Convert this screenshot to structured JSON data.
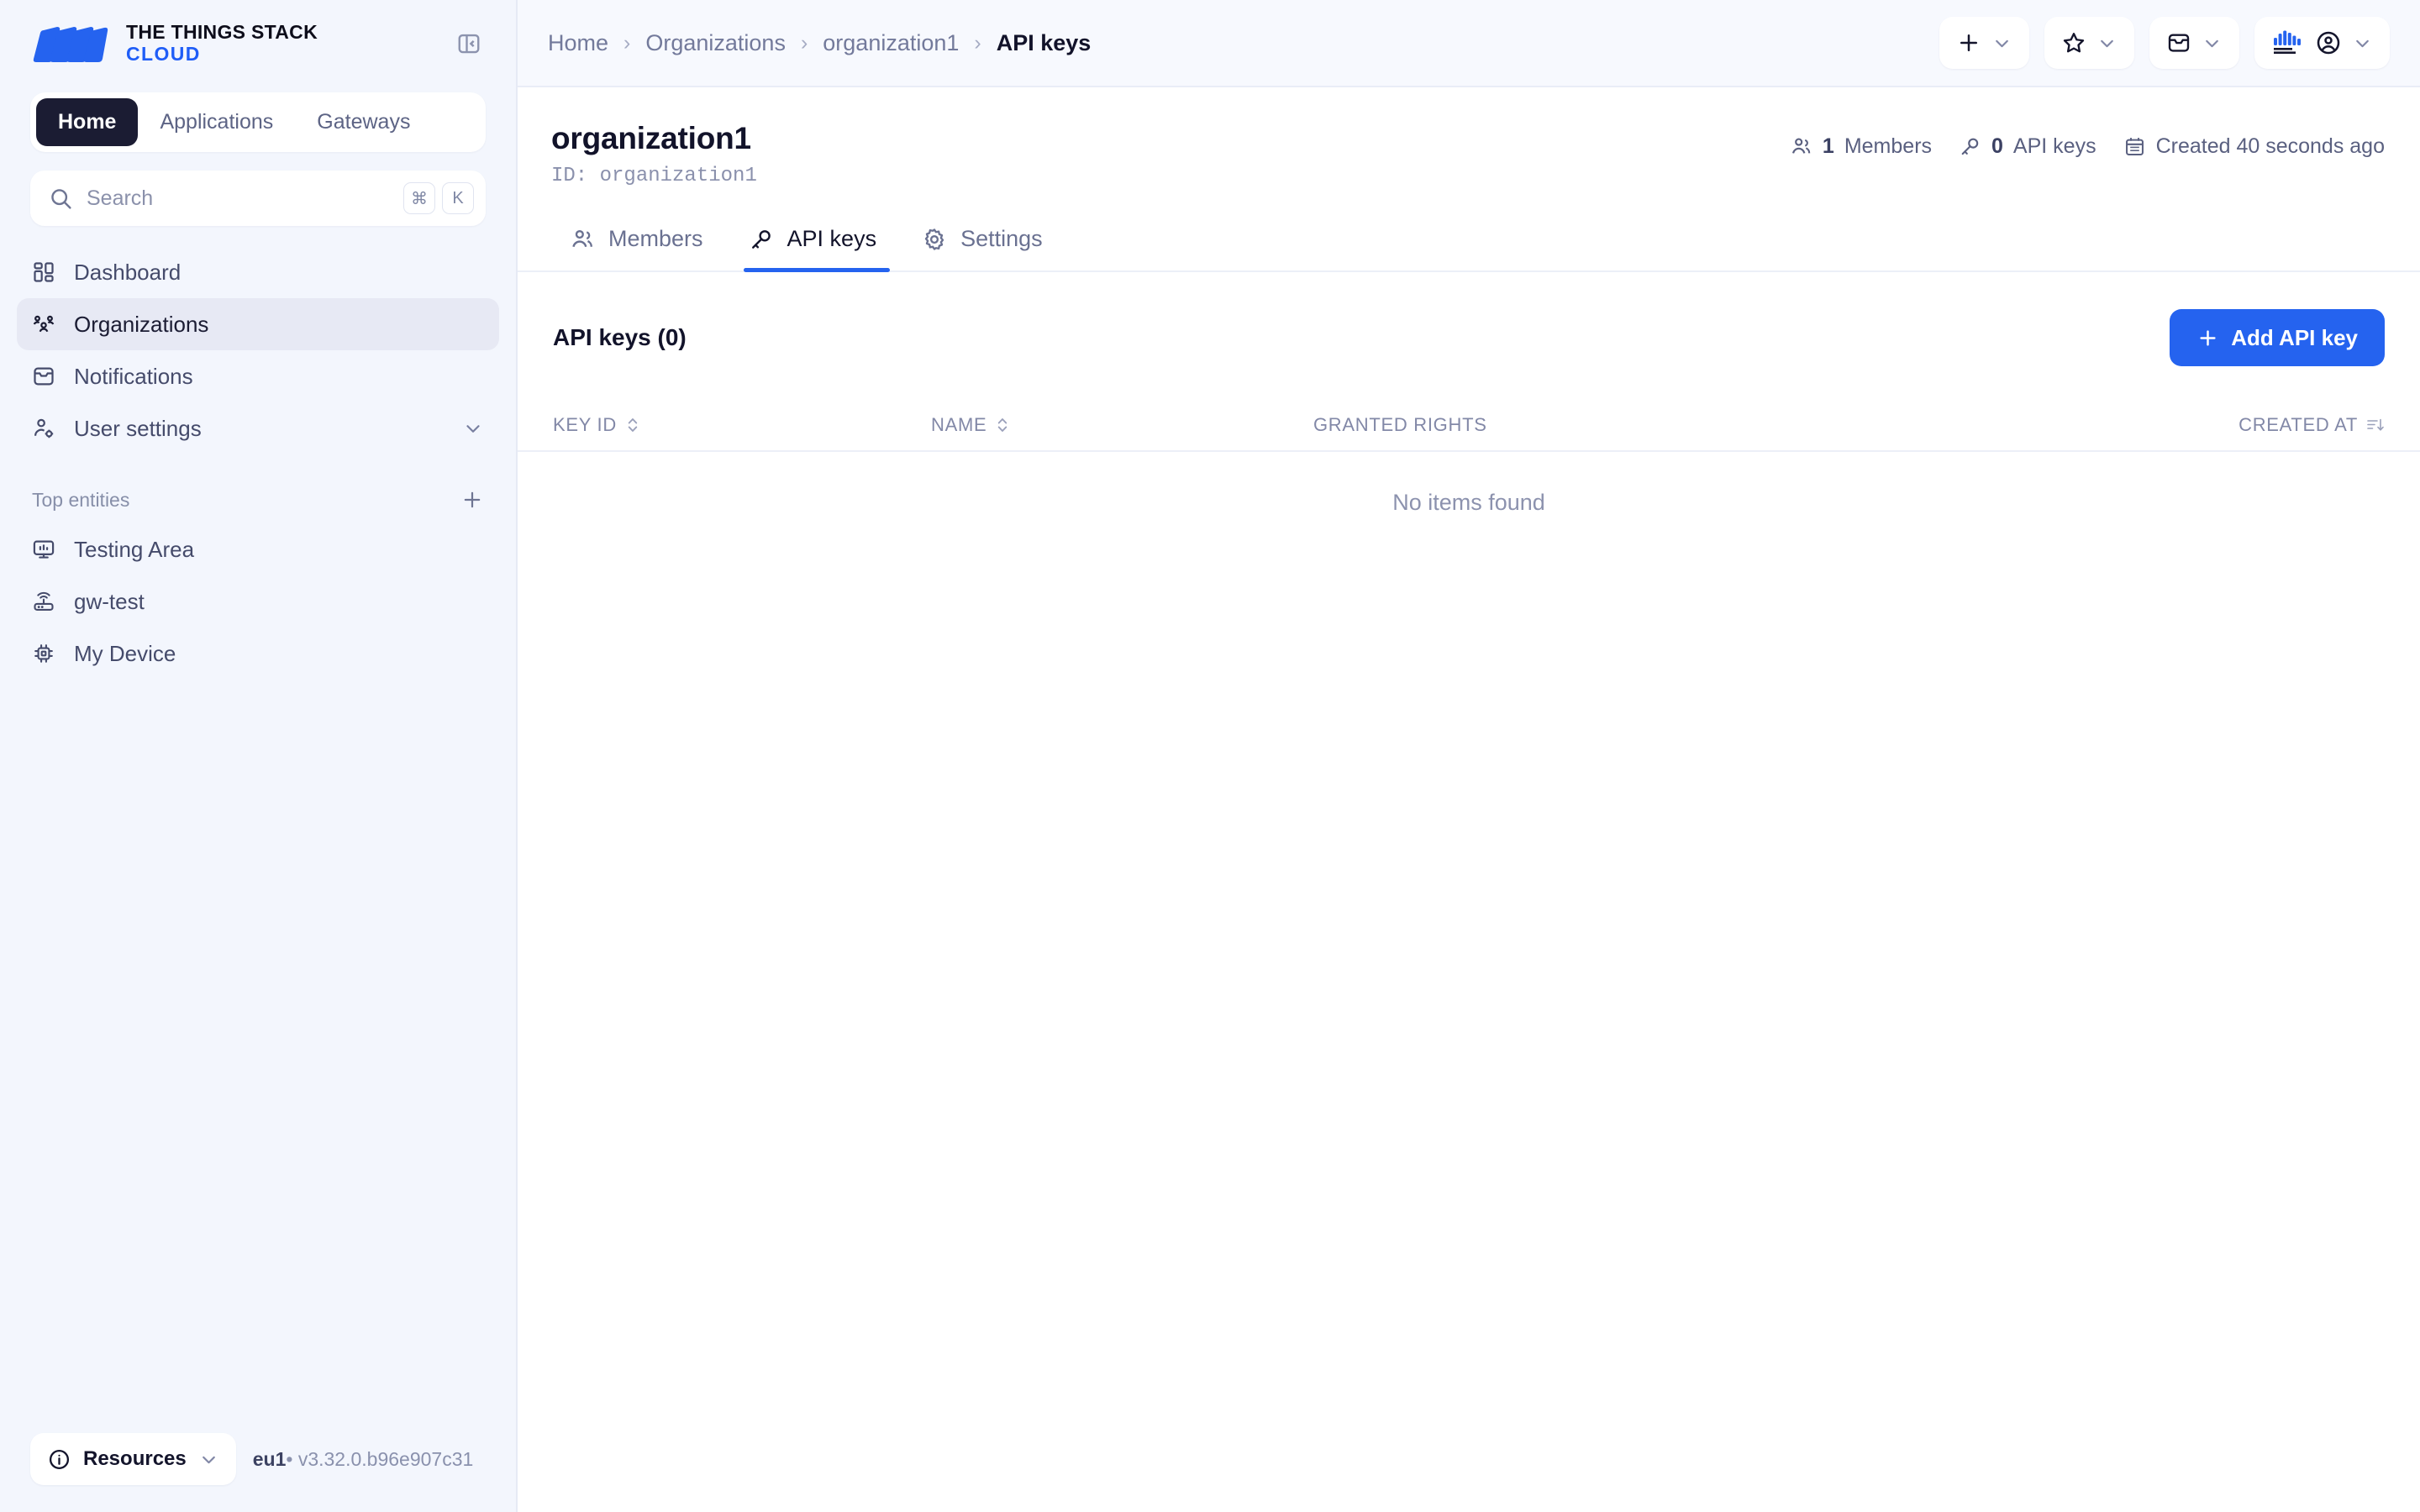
{
  "brand": {
    "line1": "THE THINGS STACK",
    "line2": "CLOUD",
    "logo_icon": "things-stack-logo",
    "accent": "#2563ef"
  },
  "sidebar": {
    "collapse_icon": "panel-collapse-icon",
    "context_tabs": [
      {
        "label": "Home",
        "active": true
      },
      {
        "label": "Applications",
        "active": false
      },
      {
        "label": "Gateways",
        "active": false
      }
    ],
    "search": {
      "placeholder": "Search",
      "value": "",
      "icon": "search-icon",
      "shortcut": [
        "⌘",
        "K"
      ]
    },
    "nav": [
      {
        "label": "Dashboard",
        "icon": "dashboard-grid-icon",
        "active": false
      },
      {
        "label": "Organizations",
        "icon": "organizations-people-icon",
        "active": true
      },
      {
        "label": "Notifications",
        "icon": "inbox-envelope-icon",
        "active": false
      },
      {
        "label": "User settings",
        "icon": "user-gear-icon",
        "active": false,
        "chevron": "chevron-down-icon"
      }
    ],
    "section": {
      "title": "Top entities",
      "add_icon": "plus-icon"
    },
    "entities": [
      {
        "label": "Testing Area",
        "icon": "application-monitor-icon"
      },
      {
        "label": "gw-test",
        "icon": "gateway-router-icon"
      },
      {
        "label": "My Device",
        "icon": "device-chip-icon"
      }
    ],
    "footer": {
      "resources_label": "Resources",
      "resources_icon": "info-circle-icon",
      "resources_chevron": "chevron-down-icon",
      "cluster": "eu1",
      "separator": "•",
      "version": "v3.32.0.b96e907c31"
    }
  },
  "topbar": {
    "breadcrumbs": [
      {
        "label": "Home",
        "current": false
      },
      {
        "label": "Organizations",
        "current": false
      },
      {
        "label": "organization1",
        "current": false
      },
      {
        "label": "API keys",
        "current": true
      }
    ],
    "separator": "›",
    "buttons": [
      {
        "name": "add-entity-button",
        "icon": "plus-icon",
        "chevron": "chevron-down-icon"
      },
      {
        "name": "bookmarks-button",
        "icon": "star-icon",
        "chevron": "chevron-down-icon"
      },
      {
        "name": "notifications-button",
        "icon": "inbox-envelope-icon",
        "chevron": "chevron-down-icon"
      },
      {
        "name": "account-button",
        "icon": "the-things-industries-logo",
        "avatar": "user-avatar-icon",
        "chevron": "chevron-down-icon"
      }
    ]
  },
  "page": {
    "title": "organization1",
    "id_label": "ID: organization1",
    "meta": [
      {
        "icon": "people-icon",
        "count": "1",
        "label": "Members"
      },
      {
        "icon": "key-icon",
        "count": "0",
        "label": "API keys"
      },
      {
        "icon": "calendar-icon",
        "count": "",
        "label": "Created 40 seconds ago"
      }
    ],
    "tabs": [
      {
        "label": "Members",
        "icon": "people-icon",
        "active": false
      },
      {
        "label": "API keys",
        "icon": "key-icon",
        "active": true
      },
      {
        "label": "Settings",
        "icon": "gear-icon",
        "active": false
      }
    ]
  },
  "list": {
    "title": "API keys (0)",
    "add_button": {
      "label": "Add API key",
      "icon": "plus-icon"
    },
    "columns": [
      {
        "label": "KEY ID",
        "sort_icon": "sort-updown-icon",
        "sortable": true
      },
      {
        "label": "NAME",
        "sort_icon": "sort-updown-icon",
        "sortable": true
      },
      {
        "label": "GRANTED RIGHTS",
        "sort_icon": "",
        "sortable": false
      },
      {
        "label": "CREATED AT",
        "sort_icon": "sort-descending-icon",
        "sortable": true
      }
    ],
    "rows": [],
    "empty_text": "No items found"
  }
}
